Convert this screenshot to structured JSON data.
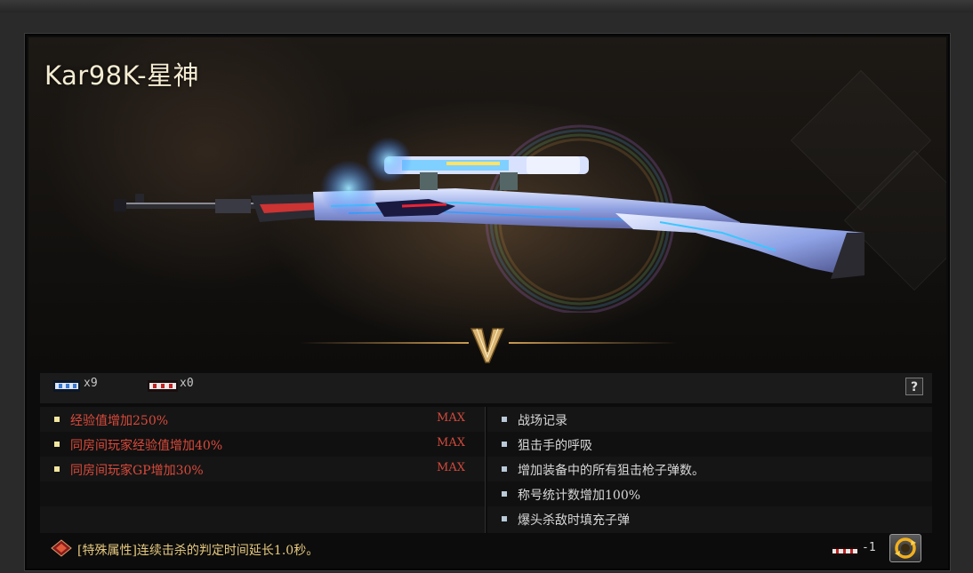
{
  "weapon": {
    "name": "Kar98K-星神",
    "grade_icon": "grade-v-emblem-icon"
  },
  "stats": {
    "chip1_count": "x9",
    "chip2_count": "x0",
    "help_label": "?"
  },
  "attributes_left": [
    {
      "text": "经验值增加250%",
      "max": "MAX"
    },
    {
      "text": "同房间玩家经验值增加40%",
      "max": "MAX"
    },
    {
      "text": "同房间玩家GP增加30%",
      "max": "MAX"
    }
  ],
  "attributes_right": [
    {
      "text": "战场记录"
    },
    {
      "text": "狙击手的呼吸"
    },
    {
      "text": "增加装备中的所有狙击枪子弹数。"
    },
    {
      "text": "称号统计数增加100%"
    },
    {
      "text": "爆头杀敌时填充子弹"
    }
  ],
  "footer": {
    "special_text": "[特殊属性]连续击杀的判定时间延长1.0秒。",
    "cost_value": "-1"
  },
  "colors": {
    "attr_red": "#d94a3b",
    "attr_white": "#d8d8d8",
    "special_gold": "#e6c97e",
    "title_cream": "#f4ecd2"
  }
}
